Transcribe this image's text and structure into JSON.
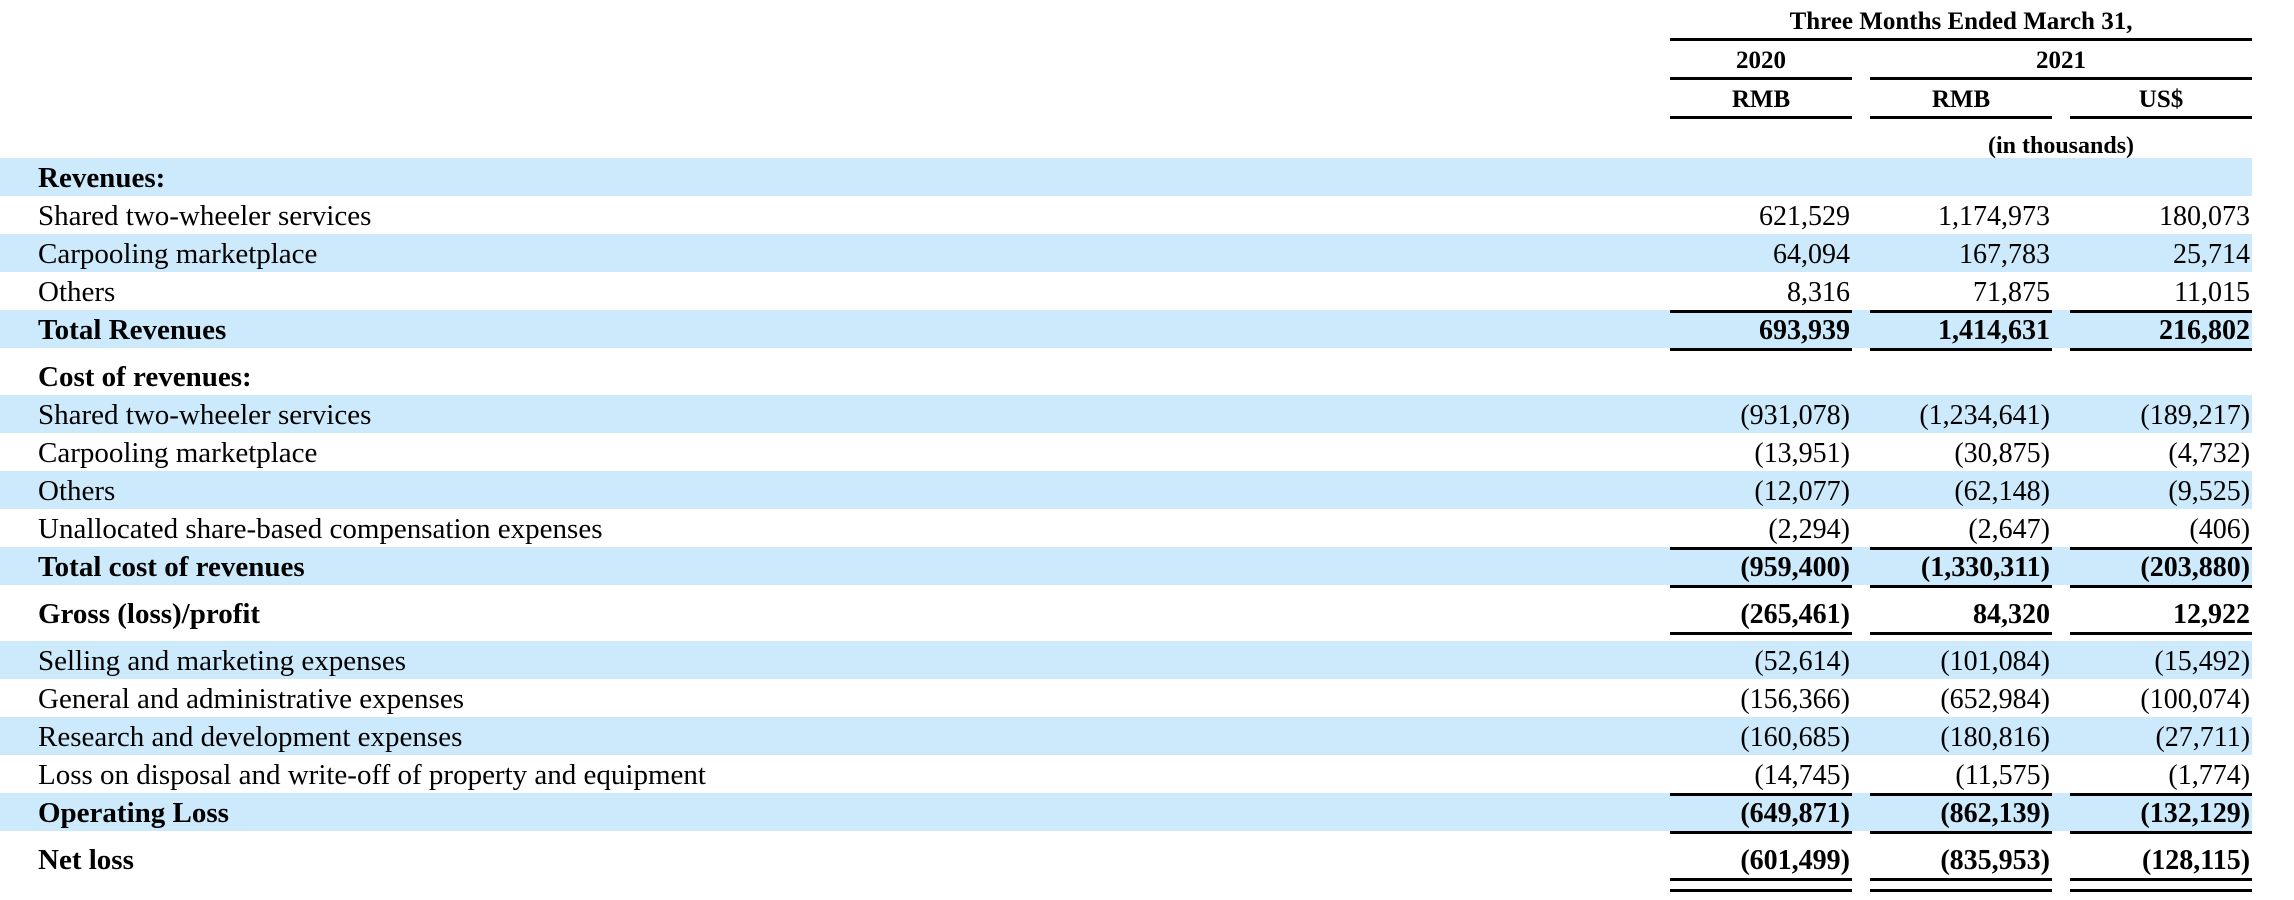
{
  "table": {
    "header": {
      "period_title": "Three Months Ended March 31,",
      "year_2020": "2020",
      "year_2021": "2021",
      "currency_2020_rmb": "RMB",
      "currency_2021_rmb": "RMB",
      "currency_2021_usd": "US$",
      "units_note": "(in thousands)"
    },
    "columns": [
      "2020 RMB",
      "2021 RMB",
      "2021 US$"
    ],
    "rows": [
      {
        "label": "Revenues:",
        "v1": "",
        "v2": "",
        "v3": ""
      },
      {
        "label": "Shared two-wheeler services",
        "v1": "621,529",
        "v2": "1,174,973",
        "v3": "180,073"
      },
      {
        "label": "Carpooling marketplace",
        "v1": "64,094",
        "v2": "167,783",
        "v3": "25,714"
      },
      {
        "label": "Others",
        "v1": "8,316",
        "v2": "71,875",
        "v3": "11,015"
      },
      {
        "label": "Total Revenues",
        "v1": "693,939",
        "v2": "1,414,631",
        "v3": "216,802"
      },
      {
        "label": "Cost of revenues:",
        "v1": "",
        "v2": "",
        "v3": ""
      },
      {
        "label": "Shared two-wheeler services",
        "v1": "(931,078)",
        "v2": "(1,234,641)",
        "v3": "(189,217)"
      },
      {
        "label": "Carpooling marketplace",
        "v1": "(13,951)",
        "v2": "(30,875)",
        "v3": "(4,732)"
      },
      {
        "label": "Others",
        "v1": "(12,077)",
        "v2": "(62,148)",
        "v3": "(9,525)"
      },
      {
        "label": "Unallocated share-based compensation expenses",
        "v1": "(2,294)",
        "v2": "(2,647)",
        "v3": "(406)"
      },
      {
        "label": "Total cost of revenues",
        "v1": "(959,400)",
        "v2": "(1,330,311)",
        "v3": "(203,880)"
      },
      {
        "label": "Gross (loss)/profit",
        "v1": "(265,461)",
        "v2": "84,320",
        "v3": "12,922"
      },
      {
        "label": "Selling and marketing expenses",
        "v1": "(52,614)",
        "v2": "(101,084)",
        "v3": "(15,492)"
      },
      {
        "label": "General and administrative expenses",
        "v1": "(156,366)",
        "v2": "(652,984)",
        "v3": "(100,074)"
      },
      {
        "label": "Research and development expenses",
        "v1": "(160,685)",
        "v2": "(180,816)",
        "v3": "(27,711)"
      },
      {
        "label": "Loss on disposal and write-off of property and equipment",
        "v1": "(14,745)",
        "v2": "(11,575)",
        "v3": "(1,774)"
      },
      {
        "label": "Operating Loss",
        "v1": "(649,871)",
        "v2": "(862,139)",
        "v3": "(132,129)"
      },
      {
        "label": "Net loss",
        "v1": "(601,499)",
        "v2": "(835,953)",
        "v3": "(128,115)"
      }
    ],
    "colors": {
      "stripe": "#cdeafc",
      "rule": "#000000",
      "text": "#000000",
      "background": "#ffffff"
    }
  }
}
